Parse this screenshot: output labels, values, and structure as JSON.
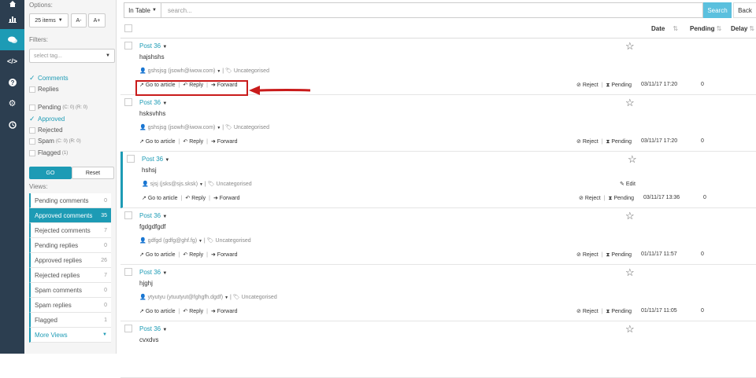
{
  "nav": {
    "icons": [
      "home-icon",
      "bar-chart-icon",
      "comments-icon",
      "code-icon",
      "help-icon",
      "settings-icon",
      "clock-icon"
    ]
  },
  "sidebar": {
    "options_label": "Options:",
    "items_per_page": "25 items",
    "font_decrease": "A-",
    "font_increase": "A+",
    "filters_label": "Filters:",
    "tag_placeholder": "select tag...",
    "filter_type": [
      {
        "label": "Comments",
        "checked": true
      },
      {
        "label": "Replies",
        "checked": false
      }
    ],
    "filter_status": [
      {
        "label": "Pending",
        "extra": "(C: 0) (R: 0)",
        "checked": false
      },
      {
        "label": "Approved",
        "extra": "",
        "checked": true
      },
      {
        "label": "Rejected",
        "extra": "",
        "checked": false
      },
      {
        "label": "Spam",
        "extra": "(C: 0) (R: 0)",
        "checked": false
      },
      {
        "label": "Flagged",
        "extra": "(1)",
        "checked": false
      }
    ],
    "go_label": "GO",
    "reset_label": "Reset",
    "views_label": "Views:",
    "views": [
      {
        "label": "Pending comments",
        "count": "0"
      },
      {
        "label": "Approved comments",
        "count": "35"
      },
      {
        "label": "Rejected comments",
        "count": "7"
      },
      {
        "label": "Pending replies",
        "count": "0"
      },
      {
        "label": "Approved replies",
        "count": "26"
      },
      {
        "label": "Rejected replies",
        "count": "7"
      },
      {
        "label": "Spam comments",
        "count": "0"
      },
      {
        "label": "Spam replies",
        "count": "0"
      },
      {
        "label": "Flagged",
        "count": "1"
      }
    ],
    "more_views": "More Views"
  },
  "toolbar": {
    "scope_label": "In Table",
    "search_placeholder": "search...",
    "search_button": "Search",
    "back_button": "Back"
  },
  "table": {
    "headers": {
      "date": "Date",
      "pending": "Pending",
      "delay": "Delay"
    },
    "actions": {
      "go_to_article": "Go to article",
      "reply": "Reply",
      "forward": "Forward",
      "reject": "Reject",
      "pending": "Pending",
      "edit": "Edit"
    },
    "rows": [
      {
        "post": "Post 36",
        "text": "hajshshs",
        "author": "gshsjsg (jsowh@iwow.com)",
        "category": "Uncategorised",
        "date": "03/11/17 17:20",
        "pending": "0",
        "edit": false
      },
      {
        "post": "Post 36",
        "text": "hsksvhhs",
        "author": "gshsjsg (jsowh@iwow.com)",
        "category": "Uncategorised",
        "date": "03/11/17 17:20",
        "pending": "0",
        "edit": false
      },
      {
        "post": "Post 36",
        "text": "hshsj",
        "author": "sjsj (jsks@sjs.sksk)",
        "category": "Uncategorised",
        "date": "03/11/17 13:36",
        "pending": "0",
        "edit": true
      },
      {
        "post": "Post 36",
        "text": "fgdgdfgdf",
        "author": "gdfgd (gdfg@ghf.fg)",
        "category": "Uncategorised",
        "date": "01/11/17 11:57",
        "pending": "0",
        "edit": false
      },
      {
        "post": "Post 36",
        "text": "hjghj",
        "author": "ytyutyu (ytuutyut@fghgfh.dgdf)",
        "category": "Uncategorised",
        "date": "01/11/17 11:05",
        "pending": "0",
        "edit": false
      },
      {
        "post": "Post 36",
        "text": "cvxdvs",
        "author": "",
        "category": "",
        "date": "",
        "pending": "",
        "edit": false
      }
    ]
  },
  "colors": {
    "nav_bg": "#2c3e50",
    "accent": "#1d9bb5",
    "highlight": "#c91b1b"
  }
}
